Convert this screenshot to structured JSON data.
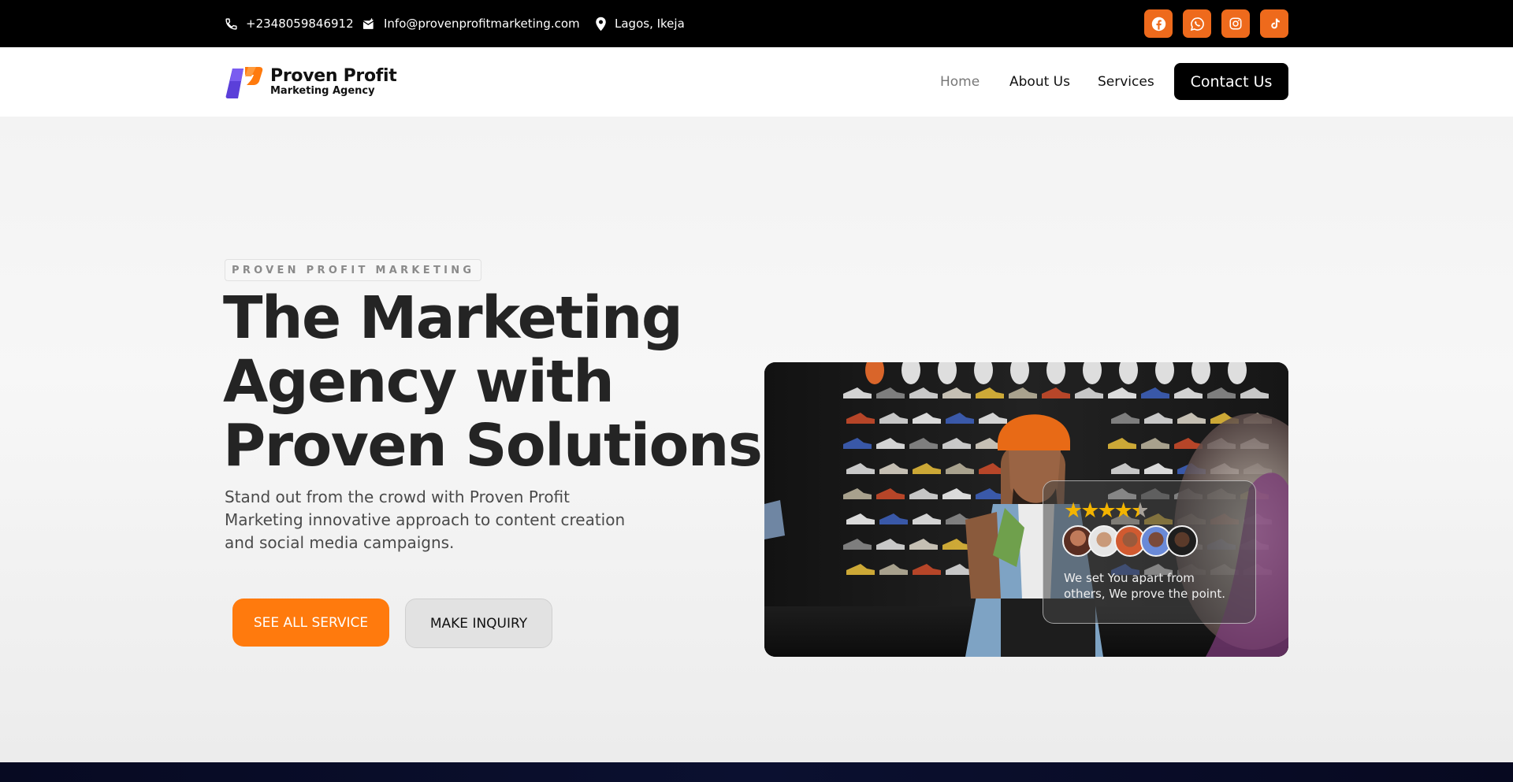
{
  "topbar": {
    "phone": "+2348059846912",
    "email": "Info@provenprofitmarketing.com",
    "location": "Lagos, Ikeja",
    "socials": [
      "facebook-icon",
      "whatsapp-icon",
      "instagram-icon",
      "tiktok-icon"
    ]
  },
  "header": {
    "logo": {
      "line1": "Proven Profit",
      "line2": "Marketing Agency"
    },
    "nav": [
      "Home",
      "About Us",
      "Services"
    ],
    "cta": "Contact Us"
  },
  "hero": {
    "eyebrow": "PROVEN PROFIT MARKETING",
    "headline": [
      "The Marketing",
      "Agency with",
      "Proven Solutions"
    ],
    "subtext": "Stand out from the crowd with Proven Profit Marketing innovative approach to content creation and social media campaigns.",
    "primary_button": "SEE ALL SERVICE",
    "secondary_button": "MAKE INQUIRY",
    "review": {
      "rating": 4.5,
      "text": "We set You apart from others, We prove the point."
    }
  },
  "colors": {
    "accent": "#ff7a0d",
    "social": "#ee6a1c",
    "topbar": "#000000"
  }
}
